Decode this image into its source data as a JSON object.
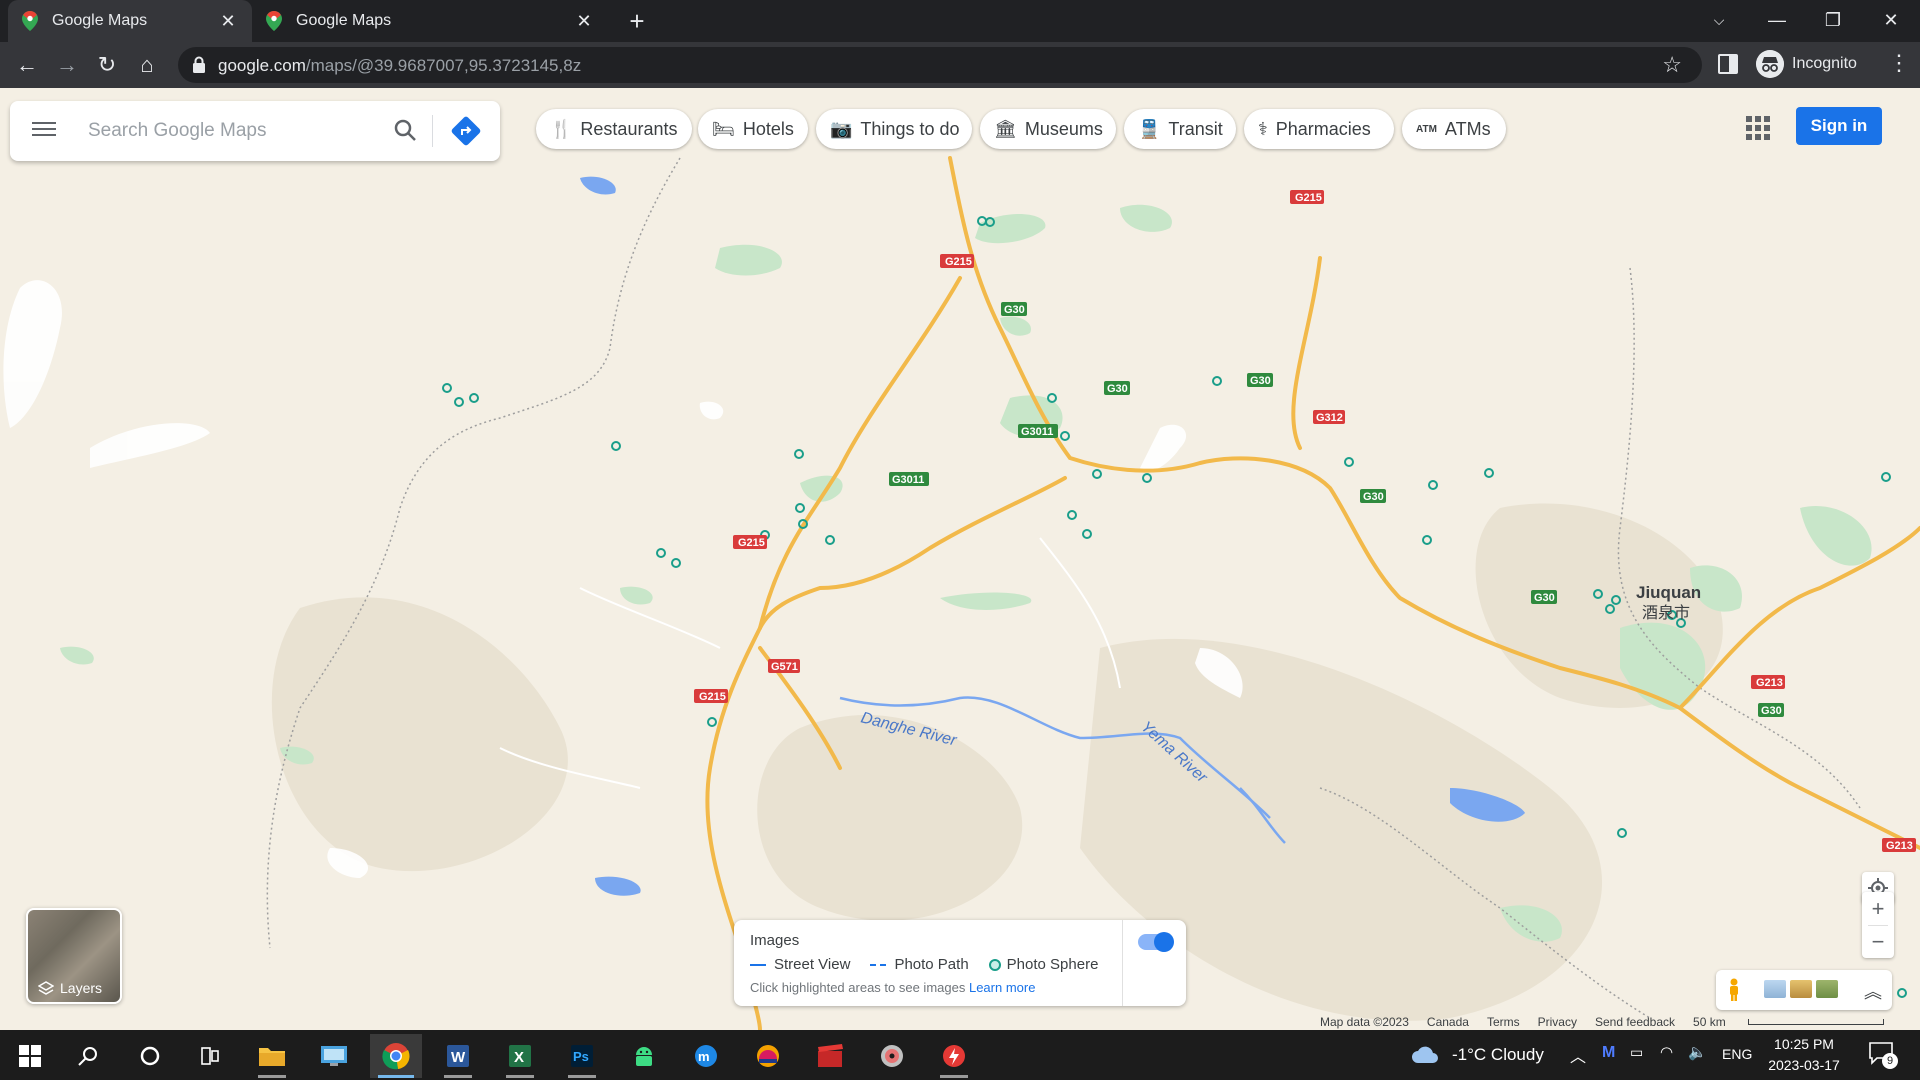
{
  "browser": {
    "tabs": [
      {
        "title": "Google Maps",
        "active": true
      },
      {
        "title": "Google Maps",
        "active": false
      }
    ],
    "url_host": "google.com",
    "url_path": "/maps/@39.9687007,95.3723145,8z",
    "profile_label": "Incognito"
  },
  "search": {
    "placeholder": "Search Google Maps"
  },
  "chips": [
    {
      "label": "Restaurants",
      "icon": "fork-knife-icon"
    },
    {
      "label": "Hotels",
      "icon": "bed-icon"
    },
    {
      "label": "Things to do",
      "icon": "camera-icon"
    },
    {
      "label": "Museums",
      "icon": "museum-icon"
    },
    {
      "label": "Transit",
      "icon": "train-icon"
    },
    {
      "label": "Pharmacies",
      "icon": "pharmacy-icon"
    },
    {
      "label": "ATMs",
      "icon": "atm-icon"
    }
  ],
  "signin_label": "Sign in",
  "layers_label": "Layers",
  "images_panel": {
    "title": "Images",
    "legend": [
      "Street View",
      "Photo Path",
      "Photo Sphere"
    ],
    "hint": "Click highlighted areas to see images",
    "link": "Learn more",
    "toggle_on": true
  },
  "map": {
    "city_label": "Jiuquan",
    "city_label_cn": "酒泉市",
    "rivers": [
      "Danghe River",
      "Yema River"
    ],
    "road_labels": [
      "G215",
      "G30",
      "G3011",
      "G312",
      "G571",
      "G213"
    ]
  },
  "footer": {
    "map_data": "Map data ©2023",
    "region": "Canada",
    "terms": "Terms",
    "privacy": "Privacy",
    "feedback": "Send feedback",
    "scale": "50 km"
  },
  "taskbar": {
    "weather": "-1°C  Cloudy",
    "lang": "ENG",
    "time": "10:25 PM",
    "date": "2023-03-17",
    "notification_count": "9"
  },
  "colors": {
    "accent": "#1a73e8",
    "highway_red": "#d93b3b",
    "highway_green": "#2f8a3e",
    "river_blue": "#7aa7f0",
    "land": "#f4efe4"
  }
}
